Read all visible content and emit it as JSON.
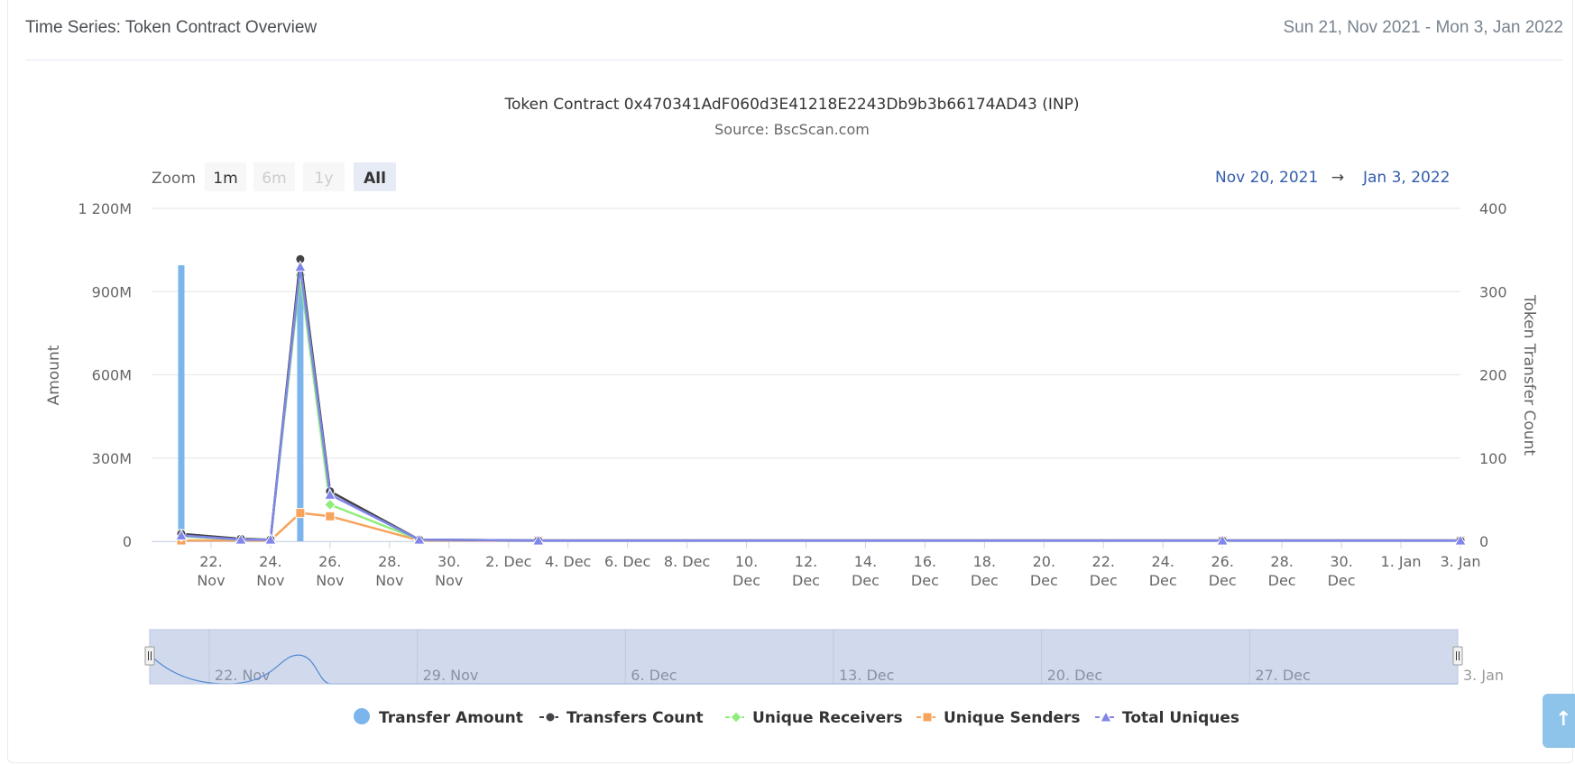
{
  "card": {
    "title": "Time Series: Token Contract Overview",
    "range": "Sun 21, Nov 2021 - Mon 3, Jan 2022"
  },
  "zoom": {
    "label": "Zoom",
    "buttons": [
      {
        "label": "1m",
        "state": "enabled"
      },
      {
        "label": "6m",
        "state": "disabled"
      },
      {
        "label": "1y",
        "state": "disabled"
      },
      {
        "label": "All",
        "state": "selected"
      }
    ]
  },
  "range_inputs": {
    "from": "Nov 20, 2021",
    "arrow": "→",
    "to": "Jan 3, 2022"
  },
  "scroll_top_icon": "arrow-up-icon",
  "chart_data": {
    "type": "line",
    "title": "Token Contract 0x470341AdF060d3E41218E2243Db9b3b66174AD43 (INP)",
    "subtitle": "Source: BscScan.com",
    "x_axis": {
      "min": "2021-11-20",
      "max": "2022-01-03",
      "ticks": [
        {
          "date": "2021-11-22",
          "label": "22. Nov"
        },
        {
          "date": "2021-11-24",
          "label": "24. Nov"
        },
        {
          "date": "2021-11-26",
          "label": "26. Nov"
        },
        {
          "date": "2021-11-28",
          "label": "28. Nov"
        },
        {
          "date": "2021-11-30",
          "label": "30. Nov"
        },
        {
          "date": "2021-12-02",
          "label": "2. Dec"
        },
        {
          "date": "2021-12-04",
          "label": "4. Dec"
        },
        {
          "date": "2021-12-06",
          "label": "6. Dec"
        },
        {
          "date": "2021-12-08",
          "label": "8. Dec"
        },
        {
          "date": "2021-12-10",
          "label": "10. Dec"
        },
        {
          "date": "2021-12-12",
          "label": "12. Dec"
        },
        {
          "date": "2021-12-14",
          "label": "14. Dec"
        },
        {
          "date": "2021-12-16",
          "label": "16. Dec"
        },
        {
          "date": "2021-12-18",
          "label": "18. Dec"
        },
        {
          "date": "2021-12-20",
          "label": "20. Dec"
        },
        {
          "date": "2021-12-22",
          "label": "22. Dec"
        },
        {
          "date": "2021-12-24",
          "label": "24. Dec"
        },
        {
          "date": "2021-12-26",
          "label": "26. Dec"
        },
        {
          "date": "2021-12-28",
          "label": "28. Dec"
        },
        {
          "date": "2021-12-30",
          "label": "30. Dec"
        },
        {
          "date": "2022-01-01",
          "label": "1. Jan"
        },
        {
          "date": "2022-01-03",
          "label": "3. Jan"
        }
      ]
    },
    "y_axes": [
      {
        "title": "Amount",
        "min": 0,
        "max": 1200000000,
        "ticks": [
          {
            "value": 0,
            "label": "0"
          },
          {
            "value": 300000000,
            "label": "300M"
          },
          {
            "value": 600000000,
            "label": "600M"
          },
          {
            "value": 900000000,
            "label": "900M"
          },
          {
            "value": 1200000000,
            "label": "1 200M"
          }
        ]
      },
      {
        "title": "Token Transfer Count",
        "min": 0,
        "max": 400,
        "ticks": [
          {
            "value": 0,
            "label": "0"
          },
          {
            "value": 100,
            "label": "100"
          },
          {
            "value": 200,
            "label": "200"
          },
          {
            "value": 300,
            "label": "300"
          },
          {
            "value": 400,
            "label": "400"
          }
        ]
      }
    ],
    "grid": true,
    "legend_position": "bottom-center",
    "series": [
      {
        "name": "Transfer Amount",
        "kind": "column",
        "axis": 0,
        "color": "#7cb5ec",
        "marker": "circle",
        "points": [
          [
            "2021-11-21",
            995000000
          ],
          [
            "2021-11-25",
            980000000
          ]
        ]
      },
      {
        "name": "Transfers Count",
        "kind": "line",
        "axis": 1,
        "color": "#434348",
        "marker": "circle",
        "points": [
          [
            "2021-11-21",
            9
          ],
          [
            "2021-11-23",
            3
          ],
          [
            "2021-11-24",
            2
          ],
          [
            "2021-11-25",
            339
          ],
          [
            "2021-11-26",
            60
          ],
          [
            "2021-11-29",
            2
          ],
          [
            "2021-12-03",
            1
          ],
          [
            "2021-12-26",
            1
          ],
          [
            "2022-01-03",
            1
          ]
        ]
      },
      {
        "name": "Unique Receivers",
        "kind": "line",
        "axis": 1,
        "color": "#90ed7d",
        "marker": "diamond",
        "points": [
          [
            "2021-11-21",
            6
          ],
          [
            "2021-11-23",
            2
          ],
          [
            "2021-11-24",
            2
          ],
          [
            "2021-11-25",
            320
          ],
          [
            "2021-11-26",
            44
          ],
          [
            "2021-11-29",
            2
          ],
          [
            "2021-12-03",
            1
          ],
          [
            "2021-12-26",
            1
          ],
          [
            "2022-01-03",
            1
          ]
        ]
      },
      {
        "name": "Unique Senders",
        "kind": "line",
        "axis": 1,
        "color": "#f7a35c",
        "marker": "square",
        "points": [
          [
            "2021-11-21",
            1
          ],
          [
            "2021-11-23",
            1
          ],
          [
            "2021-11-24",
            1
          ],
          [
            "2021-11-25",
            34
          ],
          [
            "2021-11-26",
            30
          ],
          [
            "2021-11-29",
            1
          ],
          [
            "2021-12-03",
            1
          ],
          [
            "2021-12-26",
            1
          ],
          [
            "2022-01-03",
            1
          ]
        ]
      },
      {
        "name": "Total Uniques",
        "kind": "line",
        "axis": 1,
        "color": "#8085e9",
        "marker": "triangle",
        "points": [
          [
            "2021-11-21",
            7
          ],
          [
            "2021-11-23",
            2
          ],
          [
            "2021-11-24",
            2
          ],
          [
            "2021-11-25",
            330
          ],
          [
            "2021-11-26",
            56
          ],
          [
            "2021-11-29",
            2
          ],
          [
            "2021-12-03",
            1
          ],
          [
            "2021-12-26",
            1
          ],
          [
            "2022-01-03",
            1
          ]
        ]
      }
    ]
  },
  "navigator": {
    "ticks": [
      {
        "date": "2021-11-22",
        "label": "22. Nov"
      },
      {
        "date": "2021-11-29",
        "label": "29. Nov"
      },
      {
        "date": "2021-12-06",
        "label": "6. Dec"
      },
      {
        "date": "2021-12-13",
        "label": "13. Dec"
      },
      {
        "date": "2021-12-20",
        "label": "20. Dec"
      },
      {
        "date": "2021-12-27",
        "label": "27. Dec"
      },
      {
        "date": "2022-01-03",
        "label": "3. Jan"
      }
    ]
  }
}
